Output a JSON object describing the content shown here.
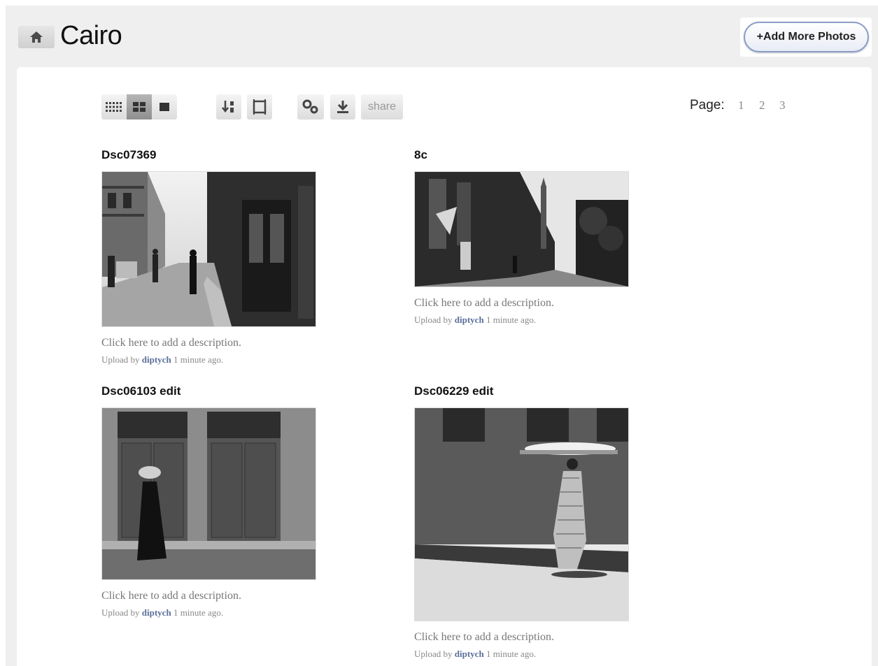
{
  "album": {
    "title": "Cairo",
    "home_icon": "house-icon",
    "add_button_label": "+Add More Photos"
  },
  "toolbar": {
    "views": [
      {
        "icon": "small-grid-icon",
        "active": false
      },
      {
        "icon": "medium-grid-icon",
        "active": true
      },
      {
        "icon": "single-view-icon",
        "active": false
      }
    ],
    "sort_icon": "sort-icon",
    "frame_icon": "frame-icon",
    "settings_icon": "gears-icon",
    "download_icon": "download-icon",
    "share_label": "share"
  },
  "pagination": {
    "label": "Page:",
    "pages": [
      "1",
      "2",
      "3"
    ]
  },
  "photos": [
    {
      "title": "Dsc07369",
      "description": "Click here to add a description.",
      "upload_prefix": "Upload by",
      "user": "diptych",
      "time": "1 minute ago."
    },
    {
      "title": "8c",
      "description": "Click here to add a description.",
      "upload_prefix": "Upload by",
      "user": "diptych",
      "time": "1 minute ago."
    },
    {
      "title": "Dsc06103 edit",
      "description": "Click here to add a description.",
      "upload_prefix": "Upload by",
      "user": "diptych",
      "time": "1 minute ago."
    },
    {
      "title": "Dsc06229 edit",
      "description": "Click here to add a description.",
      "upload_prefix": "Upload by",
      "user": "diptych",
      "time": "1 minute ago."
    }
  ],
  "colors": {
    "background": "#efefef",
    "panel": "#ffffff",
    "link": "#5b6f9a"
  }
}
